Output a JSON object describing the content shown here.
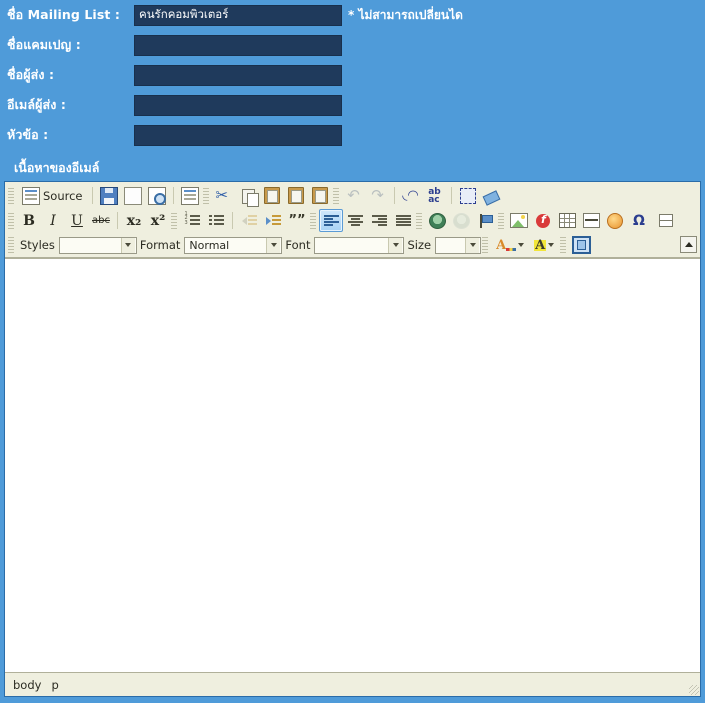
{
  "form": {
    "rows": [
      {
        "label": "ชื่อ Mailing List :",
        "value": "คนรักคอมพิวเตอร์",
        "note": "* ไม่สามารถเปลี่ยนได",
        "readonly": true
      },
      {
        "label": "ชื่อแคมเปญ :",
        "value": "",
        "note": "",
        "readonly": false
      },
      {
        "label": "ชื่อผู้ส่ง :",
        "value": "",
        "note": "",
        "readonly": false
      },
      {
        "label": "อีเมล์ผู้ส่ง :",
        "value": "",
        "note": "",
        "readonly": false
      },
      {
        "label": "หัวข้อ :",
        "value": "",
        "note": "",
        "readonly": false
      }
    ],
    "section_title": "เนื้อหาของอีเมล์"
  },
  "editor": {
    "source_label": "Source",
    "toolbar_row1": [
      {
        "name": "source-button",
        "label": "Source",
        "icon": "source-icon",
        "disabled": false
      },
      {
        "name": "save-button",
        "label": "",
        "icon": "save-icon",
        "disabled": false
      },
      {
        "name": "new-page-button",
        "label": "",
        "icon": "new-page-icon",
        "disabled": false
      },
      {
        "name": "preview-button",
        "label": "",
        "icon": "preview-icon",
        "disabled": false
      },
      {
        "name": "templates-button",
        "label": "",
        "icon": "templates-icon",
        "disabled": false
      },
      {
        "name": "cut-button",
        "label": "",
        "icon": "scissors-icon",
        "disabled": false
      },
      {
        "name": "copy-button",
        "label": "",
        "icon": "copy-icon",
        "disabled": false
      },
      {
        "name": "paste-button",
        "label": "",
        "icon": "paste-icon",
        "disabled": false
      },
      {
        "name": "paste-text-button",
        "label": "",
        "icon": "paste-text-icon",
        "disabled": false
      },
      {
        "name": "paste-from-word-button",
        "label": "",
        "icon": "paste-from-word-icon",
        "disabled": false
      },
      {
        "name": "undo-button",
        "label": "",
        "icon": "undo-arrow-icon",
        "disabled": true
      },
      {
        "name": "redo-button",
        "label": "",
        "icon": "redo-arrow-icon",
        "disabled": true
      },
      {
        "name": "find-button",
        "label": "",
        "icon": "binoculars-icon",
        "disabled": false
      },
      {
        "name": "replace-button",
        "label": "",
        "icon": "replace-icon",
        "disabled": false
      },
      {
        "name": "select-all-button",
        "label": "",
        "icon": "select-all-icon",
        "disabled": false
      },
      {
        "name": "remove-format-button",
        "label": "",
        "icon": "eraser-icon",
        "disabled": false
      }
    ],
    "toolbar_row2": [
      {
        "name": "bold-button",
        "icon": "bold-icon",
        "glyph": "B",
        "disabled": false
      },
      {
        "name": "italic-button",
        "icon": "italic-icon",
        "glyph": "I",
        "disabled": false
      },
      {
        "name": "underline-button",
        "icon": "underline-icon",
        "glyph": "U",
        "disabled": false
      },
      {
        "name": "strikethrough-button",
        "icon": "strikethrough-icon",
        "glyph": "abc",
        "disabled": false
      },
      {
        "name": "subscript-button",
        "icon": "subscript-icon",
        "glyph": "x₂",
        "disabled": false
      },
      {
        "name": "superscript-button",
        "icon": "superscript-icon",
        "glyph": "x²",
        "disabled": false
      },
      {
        "name": "numbered-list-button",
        "icon": "numbered-list-icon",
        "glyph": "",
        "disabled": false
      },
      {
        "name": "bulleted-list-button",
        "icon": "bulleted-list-icon",
        "glyph": "",
        "disabled": false
      },
      {
        "name": "outdent-button",
        "icon": "outdent-icon",
        "glyph": "",
        "disabled": true
      },
      {
        "name": "indent-button",
        "icon": "indent-icon",
        "glyph": "",
        "disabled": false
      },
      {
        "name": "blockquote-button",
        "icon": "blockquote-icon",
        "glyph": "99",
        "disabled": false
      },
      {
        "name": "align-left-button",
        "icon": "align-left-icon",
        "glyph": "",
        "disabled": false,
        "active": true
      },
      {
        "name": "align-center-button",
        "icon": "align-center-icon",
        "glyph": "",
        "disabled": false
      },
      {
        "name": "align-right-button",
        "icon": "align-right-icon",
        "glyph": "",
        "disabled": false
      },
      {
        "name": "justify-button",
        "icon": "align-justify-icon",
        "glyph": "",
        "disabled": false
      },
      {
        "name": "link-button",
        "icon": "link-icon",
        "glyph": "",
        "disabled": false
      },
      {
        "name": "unlink-button",
        "icon": "unlink-icon",
        "glyph": "",
        "disabled": true
      },
      {
        "name": "anchor-button",
        "icon": "anchor-flag-icon",
        "glyph": "",
        "disabled": false
      },
      {
        "name": "image-button",
        "icon": "image-icon",
        "glyph": "",
        "disabled": false
      },
      {
        "name": "flash-button",
        "icon": "flash-icon",
        "glyph": "",
        "disabled": false
      },
      {
        "name": "table-button",
        "icon": "table-icon",
        "glyph": "",
        "disabled": false
      },
      {
        "name": "horizontal-rule-button",
        "icon": "horizontal-rule-icon",
        "glyph": "",
        "disabled": false
      },
      {
        "name": "smiley-button",
        "icon": "smiley-icon",
        "glyph": "",
        "disabled": false
      },
      {
        "name": "special-char-button",
        "icon": "omega-icon",
        "glyph": "Ω",
        "disabled": false
      },
      {
        "name": "page-break-button",
        "icon": "page-break-icon",
        "glyph": "",
        "disabled": false
      }
    ],
    "combos": [
      {
        "name": "styles-combo",
        "label": "Styles",
        "value": ""
      },
      {
        "name": "format-combo",
        "label": "Format",
        "value": "Normal"
      },
      {
        "name": "font-combo",
        "label": "Font",
        "value": ""
      },
      {
        "name": "size-combo",
        "label": "Size",
        "value": ""
      }
    ],
    "color_buttons": [
      {
        "name": "text-color-button",
        "icon": "text-color-icon",
        "glyph": "A"
      },
      {
        "name": "background-color-button",
        "icon": "background-color-icon",
        "glyph": "A"
      }
    ],
    "maximize_button": {
      "name": "maximize-button",
      "icon": "maximize-icon"
    },
    "collapse_button": {
      "name": "collapse-toolbar-button",
      "icon": "arrow-up-icon"
    },
    "content": "",
    "elements_path": [
      "body",
      "p"
    ]
  },
  "colors": {
    "page_background": "#4f9bd9",
    "field_background": "#1f3a5c",
    "label_text": "#ffffff",
    "toolbar_background": "#efefdf",
    "editor_border": "#2a6ca8",
    "active_button": "#a8d3f4"
  }
}
